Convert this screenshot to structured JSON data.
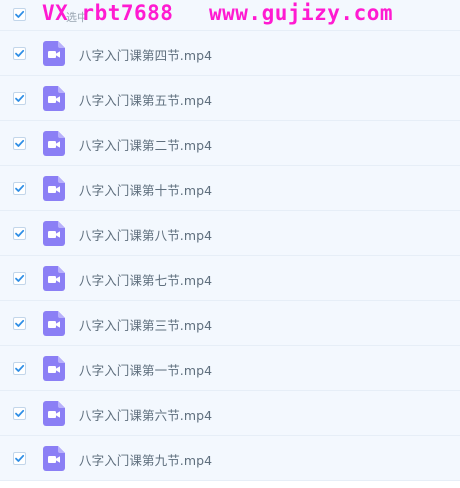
{
  "watermark": {
    "left_text": "VX rbt7688",
    "right_text": "www.gujizy.com",
    "color": "#ff1ad1"
  },
  "header": {
    "select_all_label": "选中",
    "checked": true
  },
  "files": [
    {
      "name": "八字入门课第四节.mp4",
      "checked": true,
      "icon": "video-file-icon"
    },
    {
      "name": "八字入门课第五节.mp4",
      "checked": true,
      "icon": "video-file-icon"
    },
    {
      "name": "八字入门课第二节.mp4",
      "checked": true,
      "icon": "video-file-icon"
    },
    {
      "name": "八字入门课第十节.mp4",
      "checked": true,
      "icon": "video-file-icon"
    },
    {
      "name": "八字入门课第八节.mp4",
      "checked": true,
      "icon": "video-file-icon"
    },
    {
      "name": "八字入门课第七节.mp4",
      "checked": true,
      "icon": "video-file-icon"
    },
    {
      "name": "八字入门课第三节.mp4",
      "checked": true,
      "icon": "video-file-icon"
    },
    {
      "name": "八字入门课第一节.mp4",
      "checked": true,
      "icon": "video-file-icon"
    },
    {
      "name": "八字入门课第六节.mp4",
      "checked": true,
      "icon": "video-file-icon"
    },
    {
      "name": "八字入门课第九节.mp4",
      "checked": true,
      "icon": "video-file-icon"
    }
  ],
  "colors": {
    "checkmark": "#2f8fe6",
    "icon": "#8b7ff5",
    "row_background": "#f3f8fe"
  }
}
